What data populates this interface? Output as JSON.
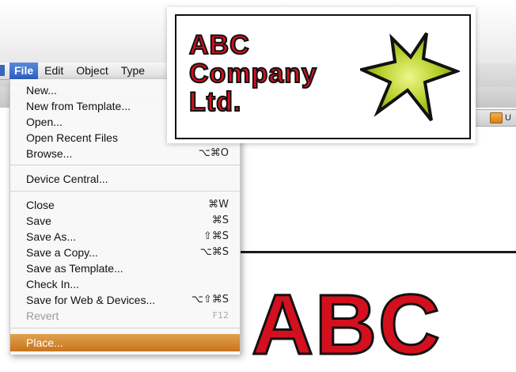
{
  "menubar": {
    "items": [
      {
        "label": "File",
        "active": true
      },
      {
        "label": "Edit",
        "active": false
      },
      {
        "label": "Object",
        "active": false
      },
      {
        "label": "Type",
        "active": false
      }
    ]
  },
  "file_menu": {
    "items": [
      {
        "label": "New...",
        "shortcut": ""
      },
      {
        "label": "New from Template...",
        "shortcut": ""
      },
      {
        "label": "Open...",
        "shortcut": ""
      },
      {
        "label": "Open Recent Files",
        "shortcut": ""
      },
      {
        "label": "Browse...",
        "shortcut": "⌥⌘O"
      },
      {
        "label": "Device Central...",
        "shortcut": ""
      },
      {
        "label": "Close",
        "shortcut": "⌘W"
      },
      {
        "label": "Save",
        "shortcut": "⌘S"
      },
      {
        "label": "Save As...",
        "shortcut": "⇧⌘S"
      },
      {
        "label": "Save a Copy...",
        "shortcut": "⌥⌘S"
      },
      {
        "label": "Save as Template...",
        "shortcut": ""
      },
      {
        "label": "Check In...",
        "shortcut": ""
      },
      {
        "label": "Save for Web & Devices...",
        "shortcut": "⌥⇧⌘S"
      },
      {
        "label": "Revert",
        "shortcut": "F12",
        "disabled": true
      },
      {
        "label": "Place...",
        "shortcut": "",
        "highlighted": true
      }
    ]
  },
  "document_tab": {
    "label": "U"
  },
  "logo": {
    "line1": "ABC",
    "line2": "Company",
    "line3": "Ltd.",
    "star_fill": "#a8c81e",
    "text_color": "#d4101e"
  },
  "canvas": {
    "big_text": "ABC"
  },
  "colors": {
    "highlight": "#d08a2e",
    "menubar_active": "#3a6cc9"
  }
}
